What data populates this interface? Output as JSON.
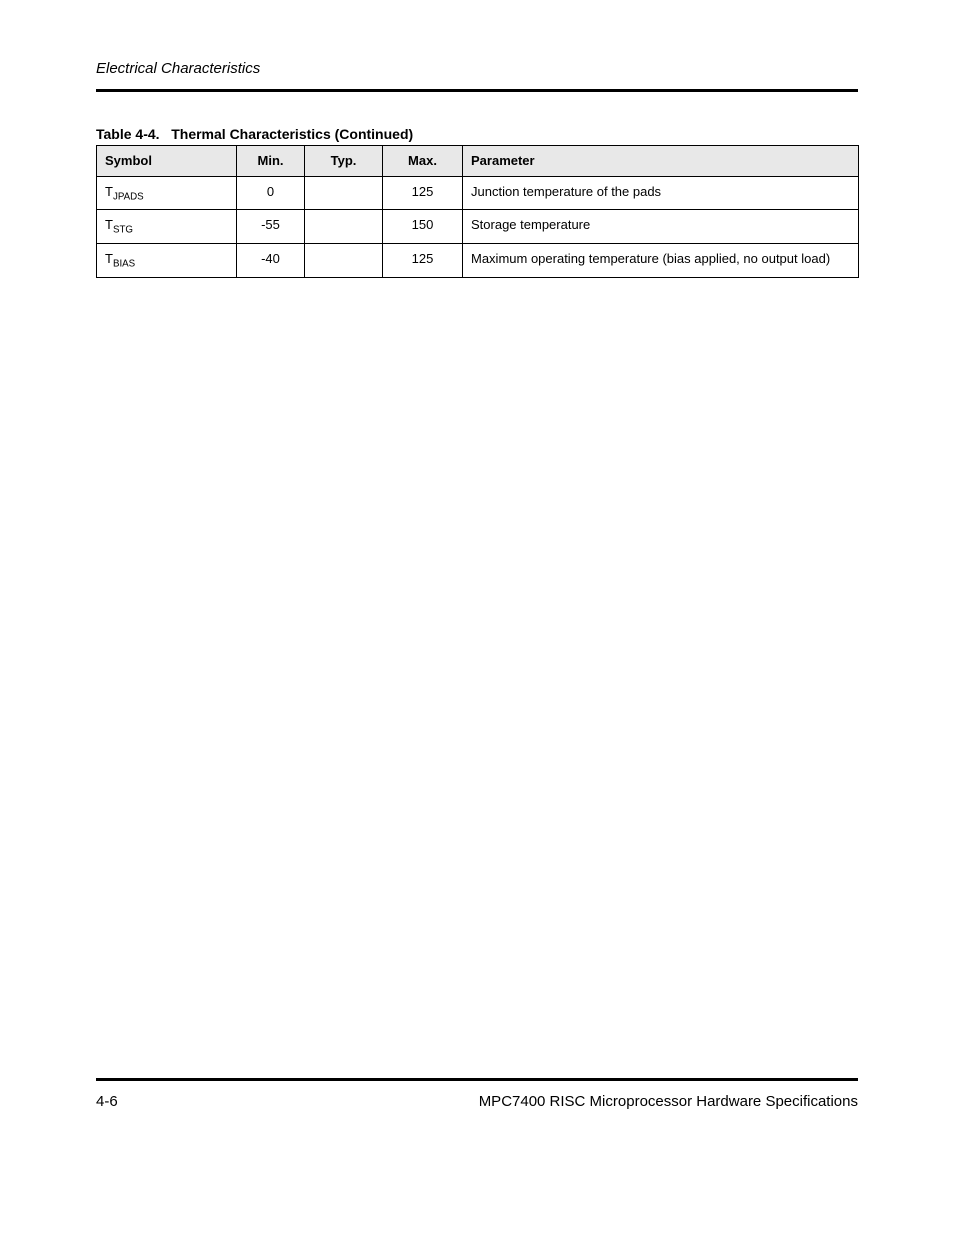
{
  "header": {
    "running_title": "Electrical Characteristics"
  },
  "table": {
    "number": "Table 4-4.",
    "title": "Thermal Characteristics (Continued)",
    "headers": [
      "Symbol",
      "Min.",
      "Typ.",
      "Max.",
      "Parameter"
    ],
    "rows": [
      {
        "symbol_html": "T<sub>JPADS</sub>",
        "min": "0",
        "typ": "",
        "max": "125",
        "param": "Junction temperature of the pads"
      },
      {
        "symbol_html": "T<sub>STG</sub>",
        "min": "-55",
        "typ": "",
        "max": "150",
        "param": "Storage temperature"
      },
      {
        "symbol_html": "T<sub>BIAS</sub>",
        "min": "-40",
        "typ": "",
        "max": "125",
        "param": "Maximum operating temperature (bias applied, no output load)"
      }
    ]
  },
  "footer": {
    "page_number": "4-6",
    "doc_id": "MPC7400 RISC Microprocessor Hardware Specifications"
  }
}
